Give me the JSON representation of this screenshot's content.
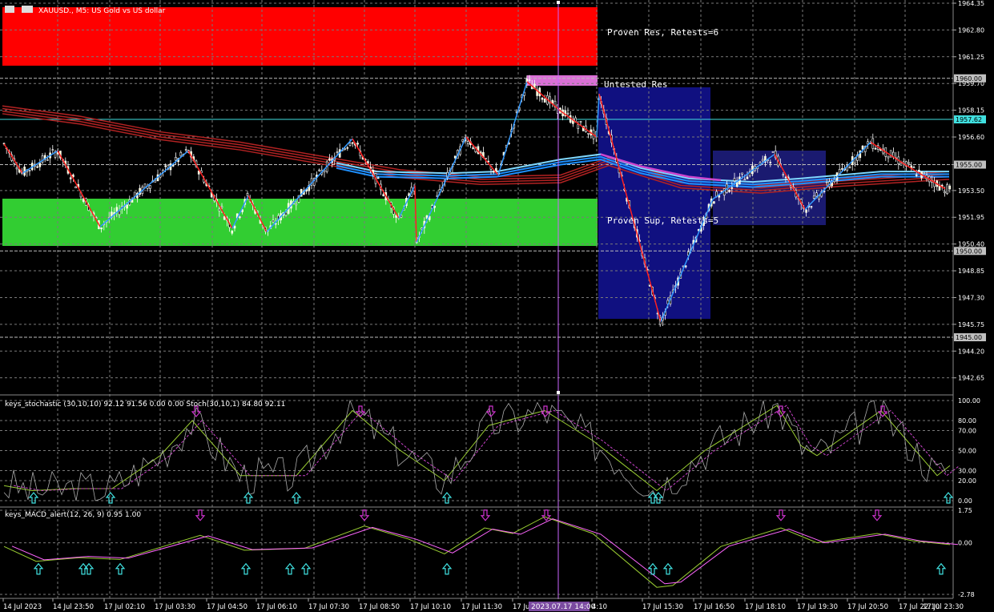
{
  "header": {
    "symbol_text": "XAUUSD., M5: US Gold vs US dollar"
  },
  "zones": {
    "proven_res_label": "Proven Res, Retests=6",
    "untested_res_label": "Untested Res",
    "proven_sup_label": "Proven Sup, Retests=5"
  },
  "price_axis": {
    "ticks": [
      "1964.35",
      "1962.80",
      "1961.25",
      "1959.70",
      "1958.15",
      "1956.60",
      "1955.00",
      "1953.50",
      "1951.95",
      "1950.40",
      "1948.85",
      "1947.30",
      "1945.75",
      "1944.20",
      "1942.65"
    ],
    "level_labels": [
      "1960.00",
      "1957.62",
      "1955.00",
      "1950.00",
      "1945.00"
    ]
  },
  "stoch_panel": {
    "title": "keys_stochastic (30,10,10) 92.12 91.56 0.00 0.00 Stoch(30,10,1) 84.80 92.11",
    "ticks": [
      "100.00",
      "80.00",
      "70.00",
      "50.00",
      "30.00",
      "20.00",
      "0.00"
    ]
  },
  "macd_panel": {
    "title": "keys_MACD_alert(12, 26, 9) 0.95 1.00",
    "ticks": [
      "1.75",
      "0.00",
      "-2.78"
    ]
  },
  "time_axis": {
    "labels": [
      "14 Jul 2023",
      "14 Jul 23:50",
      "17 Jul 02:10",
      "17 Jul 03:30",
      "17 Jul 04:50",
      "17 Jul 06:10",
      "17 Jul 07:30",
      "17 Jul 08:50",
      "17 Jul 10:10",
      "17 Jul 11:30",
      "17 Jul 1",
      "4:10",
      "17 Jul 15:30",
      "17 Jul 16:50",
      "17 Jul 18:10",
      "17 Jul 19:30",
      "17 Jul 20:50",
      "17 Jul 22:10",
      "17 Jul 23:30"
    ],
    "cursor_label": "2023.07.17 14:00"
  },
  "colors": {
    "background": "#000000",
    "bull_candle": "#ffffcc",
    "bear_candle": "#ffffff",
    "proven_res_zone": "#ff0000",
    "proven_sup_zone": "#32cd32",
    "untested_res_zone": "#da70d6",
    "box_zone": "#101080",
    "zigzag_up": "#3399ff",
    "zigzag_down": "#ff2020",
    "ma_slow": "#b22222",
    "ma_fast": "#1e90ff",
    "crosshair": "#cc66ff",
    "up_arrow": "#40e0e0",
    "down_arrow": "#cc33cc"
  },
  "chart_data": [
    {
      "type": "candlestick",
      "title": "XAUUSD., M5: US Gold vs US dollar",
      "ylim": [
        1941.8,
        1964.35
      ],
      "levels": [
        1960.0,
        1957.62,
        1955.0,
        1950.0,
        1945.0
      ],
      "zones": [
        {
          "name": "Proven Res, Retests=6",
          "from": 1961.0,
          "to": 1964.35
        },
        {
          "name": "Untested Res",
          "from": 1959.6,
          "to": 1960.15
        },
        {
          "name": "Proven Sup, Retests=5",
          "from": 1950.1,
          "to": 1952.8
        }
      ],
      "zigzag_prices": [
        1956.2,
        1954.5,
        1955.8,
        1951.4,
        1955.1,
        1951.3,
        1953.2,
        1951.1,
        1955.8,
        1951.0,
        1956.5,
        1952.5,
        1952.0,
        1950.5,
        1954.4,
        1956.0,
        1959.8,
        1958.3,
        1956.4,
        1959.1,
        1945.9,
        1953.0,
        1954.2,
        1955.6,
        1952.4,
        1955.2,
        1956.3,
        1955.1,
        1953.6
      ]
    },
    {
      "type": "line",
      "title": "keys_stochastic (30,10,10) 92.12 91.56 0.00 0.00 Stoch(30,10,1) 84.80 92.11",
      "ylim": [
        0,
        100
      ],
      "series_values_last": [
        92.12,
        91.56,
        84.8,
        92.11
      ]
    },
    {
      "type": "line",
      "title": "keys_MACD_alert(12, 26, 9) 0.95 1.00",
      "ylim": [
        -2.78,
        1.75
      ],
      "series_values_last": [
        0.95,
        1.0
      ]
    }
  ]
}
